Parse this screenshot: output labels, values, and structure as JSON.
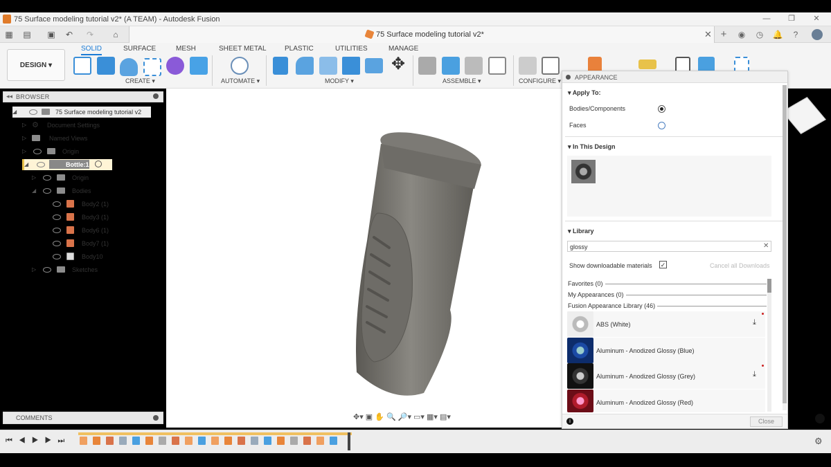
{
  "window": {
    "title": "75 Surface modeling tutorial v2* (A TEAM) - Autodesk Fusion"
  },
  "doc_tab": {
    "title": "75 Surface modeling tutorial v2*"
  },
  "workspace": {
    "label": "DESIGN ▾"
  },
  "tabs": [
    "SOLID",
    "SURFACE",
    "MESH",
    "SHEET METAL",
    "PLASTIC",
    "UTILITIES",
    "MANAGE"
  ],
  "groups": {
    "create": "CREATE ▾",
    "automate": "AUTOMATE ▾",
    "modify": "MODIFY ▾",
    "assemble": "ASSEMBLE ▾",
    "configure": "CONFIGURE ▾"
  },
  "browser": {
    "title": "BROWSER",
    "root": "75 Surface modeling tutorial v2",
    "items": [
      "Document Settings",
      "Named Views",
      "Origin"
    ],
    "component": "Bottle:1",
    "sub": [
      "Origin",
      "Bodies"
    ],
    "bodies": [
      "Body2 (1)",
      "Body3 (1)",
      "Body6 (1)",
      "Body7 (1)",
      "Body10"
    ],
    "sketches": "Sketches"
  },
  "comments": {
    "title": "COMMENTS"
  },
  "appearance": {
    "title": "APPEARANCE",
    "apply_to": "Apply To:",
    "opt1": "Bodies/Components",
    "opt2": "Faces",
    "in_design": "In This Design",
    "library": "Library",
    "search_value": "glossy",
    "show_downloadable": "Show downloadable materials",
    "cancel_downloads": "Cancel all Downloads",
    "favorites": "Favorites (0)",
    "my_appearances": "My Appearances (0)",
    "fusion_lib": "Fusion Appearance Library (46)",
    "materials": [
      "ABS (White)",
      "Aluminum - Anodized Glossy (Blue)",
      "Aluminum - Anodized Glossy (Grey)",
      "Aluminum - Anodized Glossy (Red)"
    ],
    "close": "Close"
  },
  "colors": {
    "accent": "#1a7bd6",
    "body": "#6f6d68"
  }
}
